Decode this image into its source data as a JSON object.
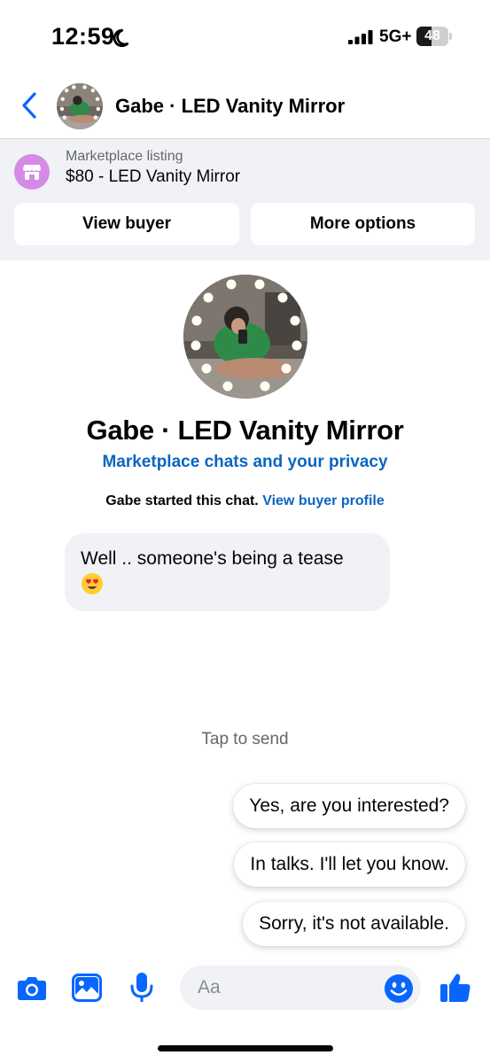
{
  "status_bar": {
    "time": "12:59",
    "network": "5G+",
    "battery_level": "48",
    "battery_fraction": 0.48
  },
  "header": {
    "title": "Gabe · LED Vanity Mirror"
  },
  "listing": {
    "subtitle": "Marketplace listing",
    "title": "$80 - LED Vanity Mirror",
    "view_buyer": "View buyer",
    "more_options": "More options"
  },
  "profile": {
    "name": "Gabe · LED Vanity Mirror",
    "privacy_link": "Marketplace chats and your privacy",
    "started_text": "Gabe started this chat.",
    "buyer_profile_link": "View buyer profile"
  },
  "messages": [
    {
      "text": "Well ..  someone's being a tease",
      "emoji": "heart-eyes-emoji"
    }
  ],
  "quick_replies": {
    "label": "Tap to send",
    "items": [
      "Yes, are you interested?",
      "In talks. I'll let you know.",
      "Sorry, it's not available."
    ]
  },
  "composer": {
    "placeholder": "Aa"
  },
  "colors": {
    "accent": "#0866ff",
    "link": "#0a66c2",
    "panel_bg": "#f0f2f5",
    "marketplace_icon": "#d58be6"
  },
  "icons": [
    "back-chevron-icon",
    "marketplace-store-icon",
    "camera-icon",
    "gallery-icon",
    "microphone-icon",
    "emoji-icon",
    "thumbs-up-icon",
    "moon-icon",
    "signal-icon",
    "battery-icon"
  ]
}
